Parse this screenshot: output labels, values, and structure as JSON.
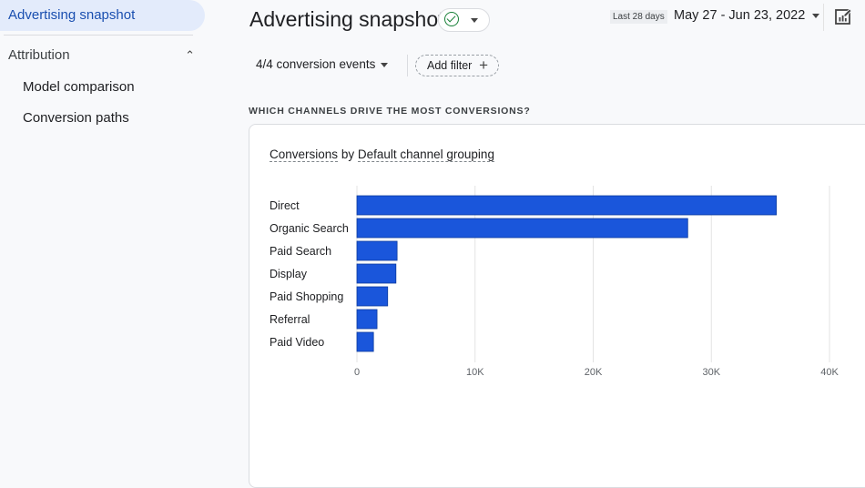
{
  "sidebar": {
    "active_item": "Advertising snapshot",
    "group_label": "Attribution",
    "group_expanded": true,
    "sub_items": [
      "Model comparison",
      "Conversion paths"
    ]
  },
  "header": {
    "title": "Advertising snapshot",
    "status_icon": "check-circle-icon",
    "events_filter": "4/4 conversion events",
    "add_filter_label": "Add filter",
    "range_label": "Last 28 days",
    "date_range": "May 27 - Jun 23, 2022",
    "edit_icon": "edit-report-icon"
  },
  "section": {
    "heading": "WHICH CHANNELS DRIVE THE MOST CONVERSIONS?",
    "card_title_metric": "Conversions",
    "card_title_by": "by",
    "card_title_dimension": "Default channel grouping"
  },
  "colors": {
    "bar": "#1a56db",
    "accent": "#1a4fb0",
    "check": "#188038"
  },
  "chart_data": {
    "type": "bar",
    "orientation": "horizontal",
    "title": "Conversions by Default channel grouping",
    "xlabel": "",
    "ylabel": "",
    "categories": [
      "Direct",
      "Organic Search",
      "Paid Search",
      "Display",
      "Paid Shopping",
      "Referral",
      "Paid Video"
    ],
    "values": [
      35500,
      28000,
      3400,
      3300,
      2600,
      1700,
      1400
    ],
    "xlim": [
      0,
      40000
    ],
    "xticks": [
      0,
      10000,
      20000,
      30000,
      40000
    ],
    "xtick_labels": [
      "0",
      "10K",
      "20K",
      "30K",
      "40K"
    ],
    "grid": true,
    "legend": "none"
  }
}
